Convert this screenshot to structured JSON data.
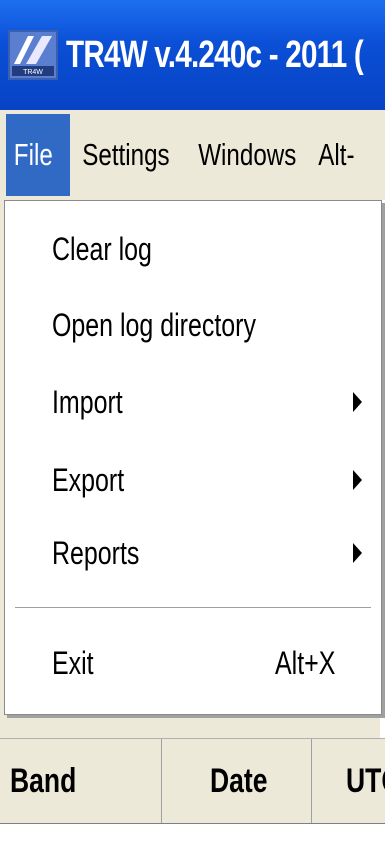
{
  "window": {
    "title": "TR4W v.4.240c - 2011 ("
  },
  "menubar": {
    "items": [
      {
        "label": "File"
      },
      {
        "label": "Settings"
      },
      {
        "label": "Windows"
      },
      {
        "label": "Alt-"
      }
    ]
  },
  "file_menu": {
    "items": [
      {
        "label": "Clear log"
      },
      {
        "label": "Open log directory"
      },
      {
        "label": "Import",
        "submenu": true
      },
      {
        "label": "Export",
        "submenu": true
      },
      {
        "label": "Reports",
        "submenu": true
      }
    ],
    "exit": {
      "label": "Exit",
      "shortcut": "Alt+X"
    }
  },
  "log_table": {
    "columns": [
      "Band",
      "Date",
      "UTC"
    ]
  },
  "colors": {
    "titlebar": "#0a4fd6",
    "menu_highlight": "#316ac5",
    "menubar_bg": "#ece9d8"
  },
  "icons": {
    "app": "tr4w-app-icon",
    "submenu": "submenu-arrow-icon"
  }
}
